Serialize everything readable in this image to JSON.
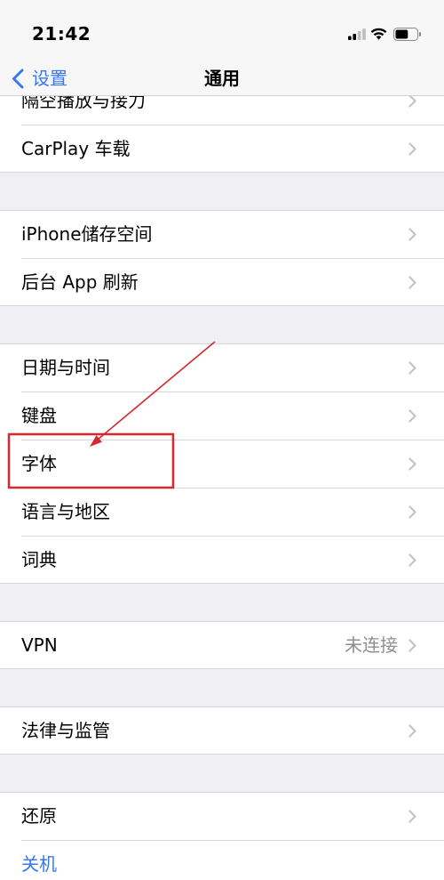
{
  "status_bar": {
    "time": "21:42",
    "signal_bars_active": 2,
    "battery_level": 0.6,
    "icons": [
      "cellular-signal-icon",
      "wifi-icon",
      "battery-icon"
    ]
  },
  "nav": {
    "back_icon": "chevron-left-icon",
    "back_label": "设置",
    "title": "通用"
  },
  "groups": [
    {
      "rows": [
        {
          "label": "隔空播放与接力",
          "icon": "chevron-right-icon"
        },
        {
          "label": "CarPlay 车载",
          "icon": "chevron-right-icon"
        }
      ]
    },
    {
      "rows": [
        {
          "label": "iPhone储存空间",
          "icon": "chevron-right-icon"
        },
        {
          "label": "后台 App 刷新",
          "icon": "chevron-right-icon"
        }
      ]
    },
    {
      "rows": [
        {
          "label": "日期与时间",
          "icon": "chevron-right-icon"
        },
        {
          "label": "键盘",
          "icon": "chevron-right-icon"
        },
        {
          "label": "字体",
          "icon": "chevron-right-icon"
        },
        {
          "label": "语言与地区",
          "icon": "chevron-right-icon"
        },
        {
          "label": "词典",
          "icon": "chevron-right-icon"
        }
      ]
    },
    {
      "rows": [
        {
          "label": "VPN",
          "value": "未连接",
          "icon": "chevron-right-icon"
        }
      ]
    },
    {
      "rows": [
        {
          "label": "法律与监管",
          "icon": "chevron-right-icon"
        }
      ]
    },
    {
      "rows": [
        {
          "label": "还原",
          "icon": "chevron-right-icon"
        },
        {
          "label": "关机"
        }
      ]
    }
  ],
  "colors": {
    "accent": "#3478f6",
    "background": "#efeff4",
    "row_background": "#ffffff",
    "separator": "#d6d6da",
    "secondary_text": "#8e8e93",
    "chevron": "#c4c4c7",
    "annotation": "#d9272e"
  }
}
